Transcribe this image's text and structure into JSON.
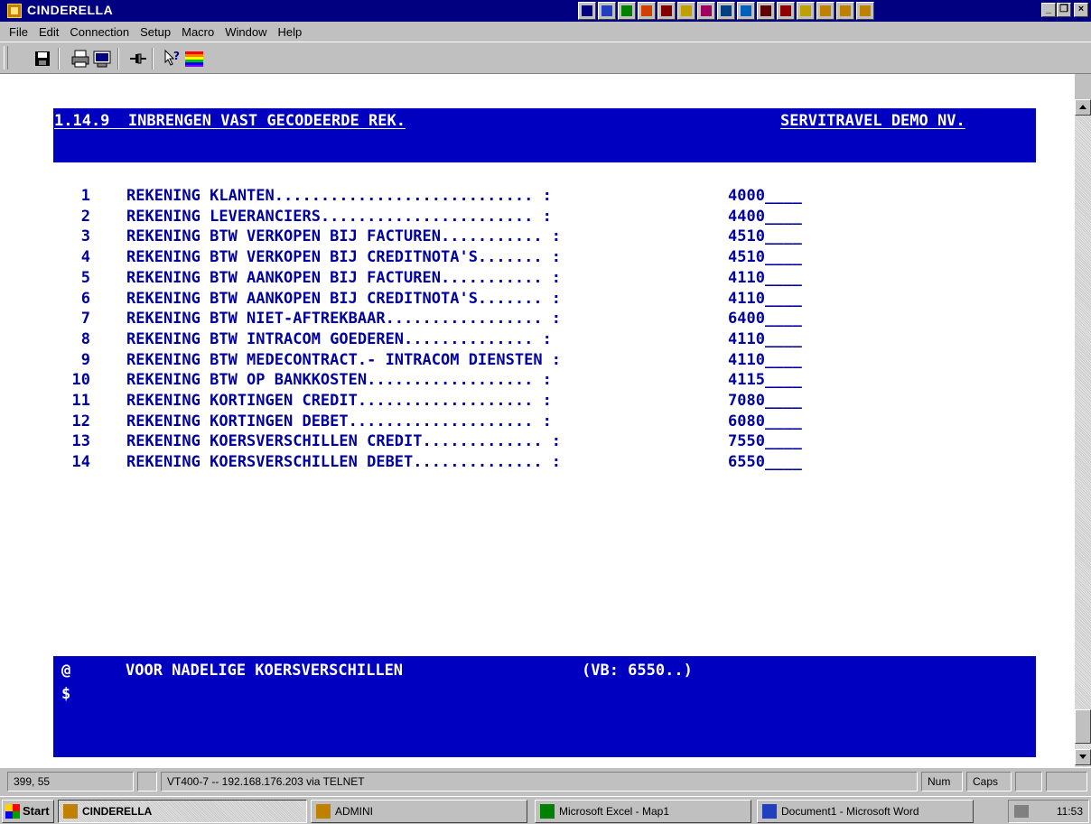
{
  "window": {
    "title": "CINDERELLA",
    "controls": [
      "minimize-icon",
      "restore-icon",
      "close-icon"
    ],
    "title_bar_color": "#000080"
  },
  "menu": [
    "File",
    "Edit",
    "Connection",
    "Setup",
    "Macro",
    "Window",
    "Help"
  ],
  "toolbar": {
    "icons": [
      "save-icon",
      "print-icon",
      "print-screen-icon",
      "connect-icon",
      "context-help-icon",
      "color-palette-icon"
    ]
  },
  "terminal": {
    "header_left": "1.14.9  INBRENGEN VAST GECODEERDE REK.",
    "header_right": "SERVITRAVEL DEMO NV.",
    "background": "#ffffff",
    "text_color": "#0000a0",
    "banner_color": "#0000c0",
    "rows": [
      {
        "num": "1",
        "label": "REKENING KLANTEN............................ :",
        "value": "4000____"
      },
      {
        "num": "2",
        "label": "REKENING LEVERANCIERS....................... :",
        "value": "4400____"
      },
      {
        "num": "3",
        "label": "REKENING BTW VERKOPEN BIJ FACTUREN........... :",
        "value": "4510____"
      },
      {
        "num": "4",
        "label": "REKENING BTW VERKOPEN BIJ CREDITNOTA'S....... :",
        "value": "4510____"
      },
      {
        "num": "5",
        "label": "REKENING BTW AANKOPEN BIJ FACTUREN........... :",
        "value": "4110____"
      },
      {
        "num": "6",
        "label": "REKENING BTW AANKOPEN BIJ CREDITNOTA'S....... :",
        "value": "4110____"
      },
      {
        "num": "7",
        "label": "REKENING BTW NIET-AFTREKBAAR................. :",
        "value": "6400____"
      },
      {
        "num": "8",
        "label": "REKENING BTW INTRACOM GOEDEREN.............. :",
        "value": "4110____"
      },
      {
        "num": "9",
        "label": "REKENING BTW MEDECONTRACT.- INTRACOM DIENSTEN :",
        "value": "4110____"
      },
      {
        "num": "10",
        "label": "REKENING BTW OP BANKKOSTEN.................. :",
        "value": "4115____"
      },
      {
        "num": "11",
        "label": "REKENING KORTINGEN CREDIT................... :",
        "value": "7080____"
      },
      {
        "num": "12",
        "label": "REKENING KORTINGEN DEBET.................... :",
        "value": "6080____"
      },
      {
        "num": "13",
        "label": "REKENING KOERSVERSCHILLEN CREDIT............. :",
        "value": "7550____"
      },
      {
        "num": "14",
        "label": "REKENING KOERSVERSCHILLEN DEBET.............. :",
        "value": "6550____"
      }
    ],
    "footer_line1_prefix": "@",
    "footer_line1_text": "VOOR NADELIGE KOERSVERSCHILLEN",
    "footer_line1_hint": "(VB: 6550..)",
    "footer_line2_prefix": "$"
  },
  "statusbar": {
    "cursor": "399, 55",
    "connection": "VT400-7 -- 192.168.176.203 via TELNET",
    "num": "Num",
    "caps": "Caps"
  },
  "taskbar": {
    "start": "Start",
    "tasks": [
      {
        "label": "CINDERELLA",
        "icon": "cinderella-icon",
        "active": true
      },
      {
        "label": "ADMINI",
        "icon": "cinderella-icon",
        "active": false
      },
      {
        "label": "Microsoft Excel - Map1",
        "icon": "excel-icon",
        "active": false
      },
      {
        "label": "Document1 - Microsoft Word",
        "icon": "word-icon",
        "active": false
      }
    ],
    "clock": "11:53"
  }
}
